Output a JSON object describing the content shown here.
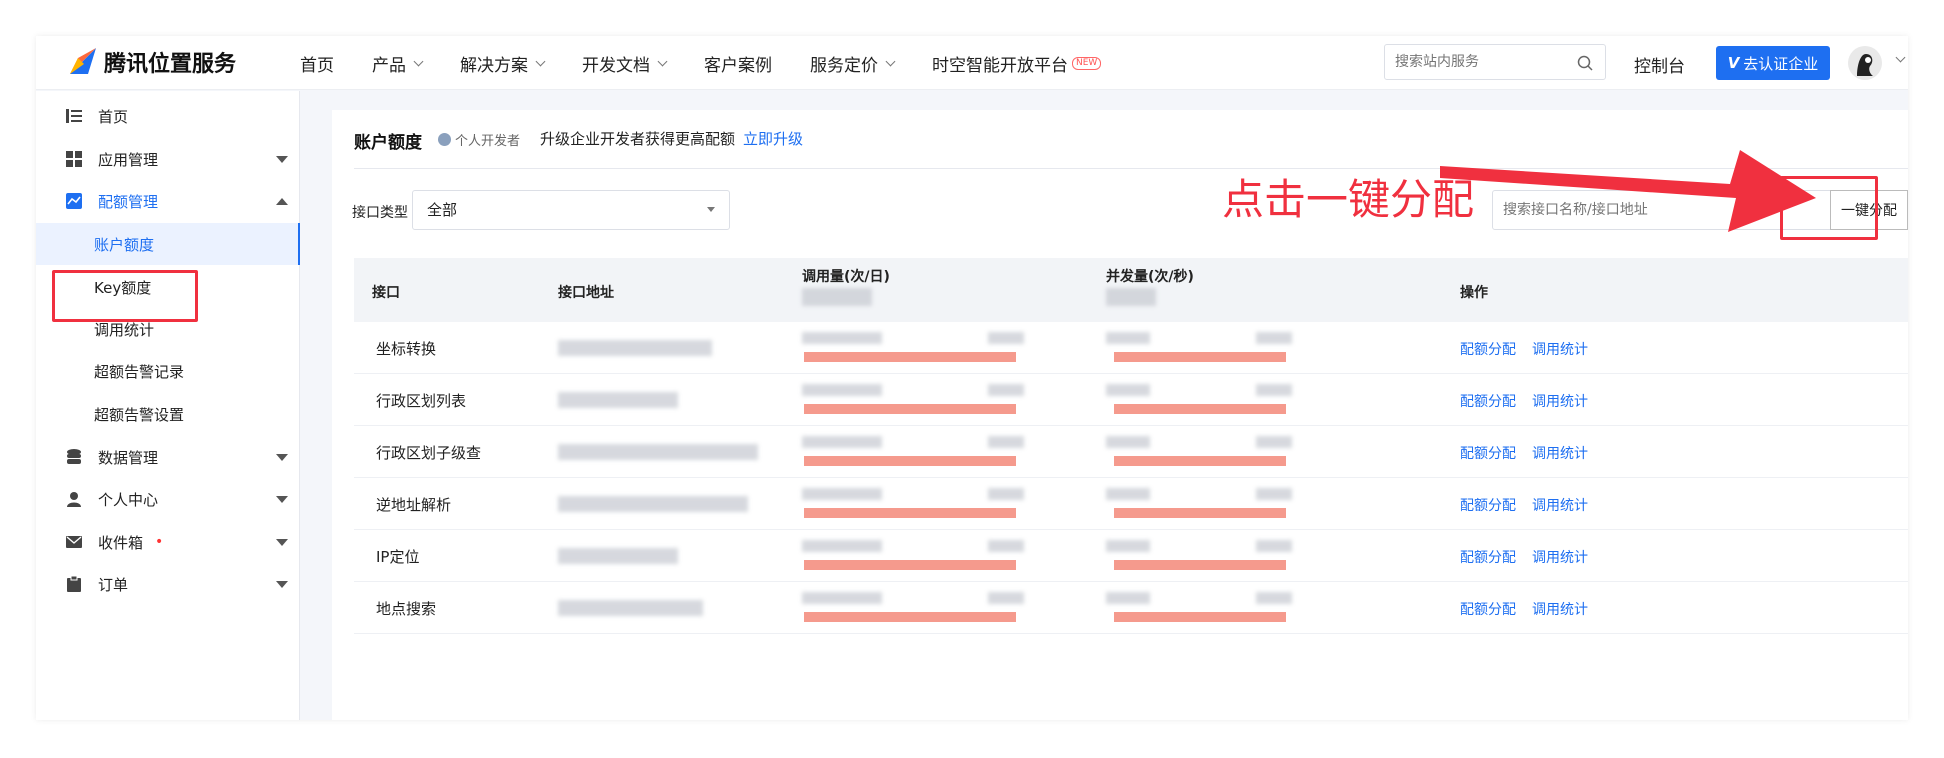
{
  "brand": {
    "name": "腾讯位置服务"
  },
  "topnav": {
    "items": [
      {
        "label": "首页",
        "has_dropdown": false,
        "new": false
      },
      {
        "label": "产品",
        "has_dropdown": true,
        "new": false
      },
      {
        "label": "解决方案",
        "has_dropdown": true,
        "new": false
      },
      {
        "label": "开发文档",
        "has_dropdown": true,
        "new": false
      },
      {
        "label": "客户案例",
        "has_dropdown": false,
        "new": false
      },
      {
        "label": "服务定价",
        "has_dropdown": true,
        "new": false
      },
      {
        "label": "时空智能开放平台",
        "has_dropdown": false,
        "new": true
      }
    ],
    "new_badge": "NEW",
    "search_placeholder": "搜索站内服务",
    "console": "控制台",
    "verify_button": "去认证企业",
    "verify_mark": "V"
  },
  "sidebar": {
    "items": [
      {
        "label": "首页",
        "icon": "list-icon",
        "arrow": "none",
        "level": 1
      },
      {
        "label": "应用管理",
        "icon": "grid-icon",
        "arrow": "down",
        "level": 1
      },
      {
        "label": "配额管理",
        "icon": "chart-icon",
        "arrow": "up",
        "level": 1,
        "open": true
      },
      {
        "label": "账户额度",
        "level": 2,
        "active": true
      },
      {
        "label": "Key额度",
        "level": 2
      },
      {
        "label": "调用统计",
        "level": 2
      },
      {
        "label": "超额告警记录",
        "level": 2
      },
      {
        "label": "超额告警设置",
        "level": 2
      },
      {
        "label": "数据管理",
        "icon": "database-icon",
        "arrow": "down",
        "level": 1
      },
      {
        "label": "个人中心",
        "icon": "user-icon",
        "arrow": "down",
        "level": 1
      },
      {
        "label": "收件箱",
        "icon": "mail-icon",
        "arrow": "down",
        "level": 1,
        "dot": "•"
      },
      {
        "label": "订单",
        "icon": "clipboard-icon",
        "arrow": "down",
        "level": 1
      }
    ]
  },
  "page": {
    "title": "账户额度",
    "tag": "个人开发者",
    "hint": "升级企业开发者获得更高配额",
    "upgrade_link": "立即升级"
  },
  "filter": {
    "type_label": "接口类型",
    "type_value": "全部",
    "search_placeholder": "搜索接口名称/接口地址",
    "allocate_button": "一键分配"
  },
  "table": {
    "headers": [
      "接口",
      "接口地址",
      "调用量(次/日)",
      "并发量(次/秒)",
      "操作"
    ],
    "rows": [
      {
        "name": "坐标转换"
      },
      {
        "name": "行政区划列表"
      },
      {
        "name": "行政区划子级查"
      },
      {
        "name": "逆地址解析"
      },
      {
        "name": "IP定位"
      },
      {
        "name": "地点搜索"
      }
    ],
    "ops": [
      "配额分配",
      "调用统计"
    ]
  },
  "annotation": {
    "text": "点击一键分配"
  },
  "colors": {
    "accent": "#1e6ff1",
    "annotation": "#f0303f",
    "bar": "#f59a8d"
  }
}
